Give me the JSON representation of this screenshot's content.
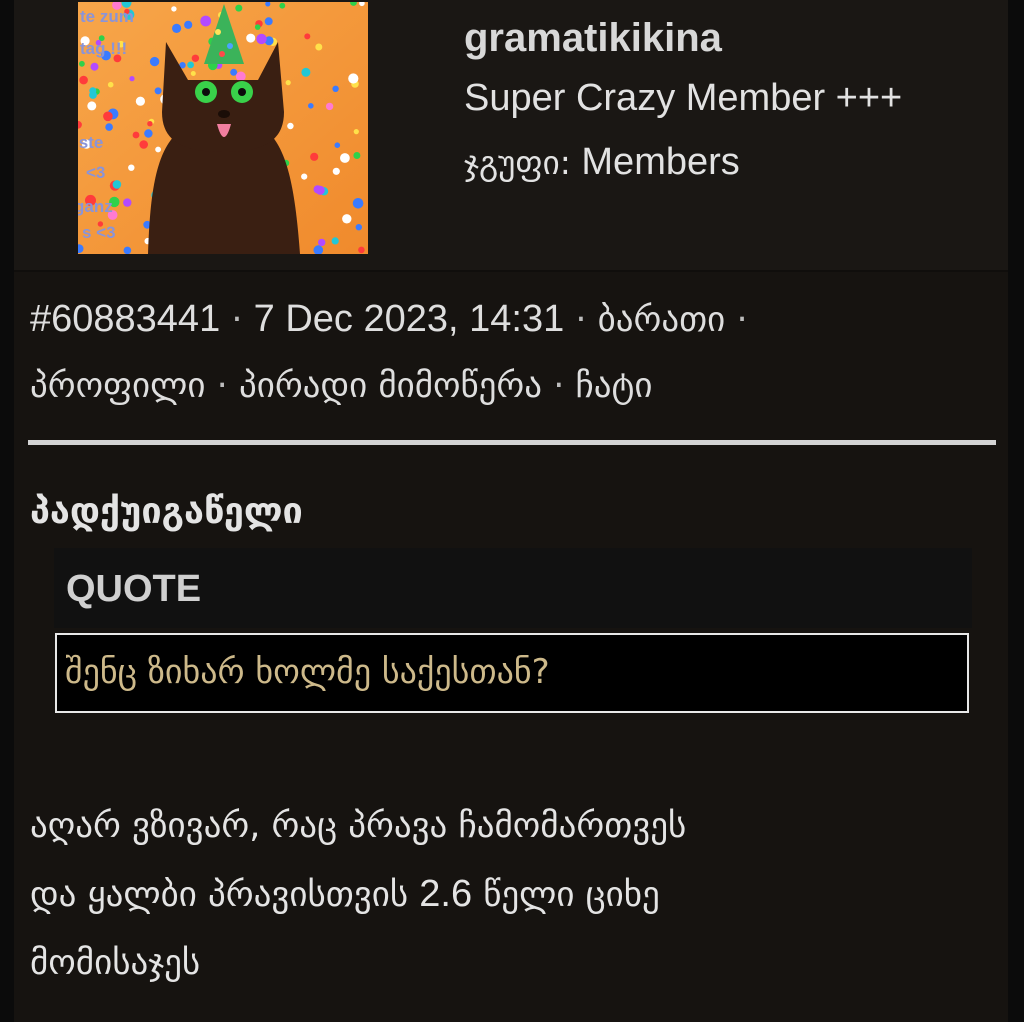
{
  "post": {
    "author": {
      "username": "gramatikikina",
      "rank": "Super Crazy Member +++",
      "group_label": "ჯგუფი:",
      "group_value": "Members",
      "avatar_icon": "party-cat-avatar",
      "avatar_text": [
        "te zum",
        "tag !!!",
        "iste",
        "<3",
        "ganz",
        "s <3"
      ]
    },
    "meta": {
      "post_id": "#60883441",
      "date": "7 Dec 2023, 14:31",
      "separator": "·",
      "links": {
        "card": "ბარათი",
        "profile": "პროფილი",
        "pm": "პირადი მიმოწერა",
        "chat": "ჩატი"
      }
    },
    "title": "პადქუიგაწელი",
    "quote": {
      "label": "QUOTE",
      "text": "შენც ზიხარ ხოლმე საქესთან?"
    },
    "body": {
      "line1": "აღარ ვზივარ, რაც პრავა ჩამომართვეს",
      "line2_start": "და ყალბი პრავისთვის",
      "line2_number": "2.6",
      "line2_end": "წელი ციხე",
      "line3": "მომისაჯეს"
    },
    "colors": {
      "background": "#161310",
      "quote_text": "#cdb98a",
      "divider": "#d4d4d4"
    }
  }
}
